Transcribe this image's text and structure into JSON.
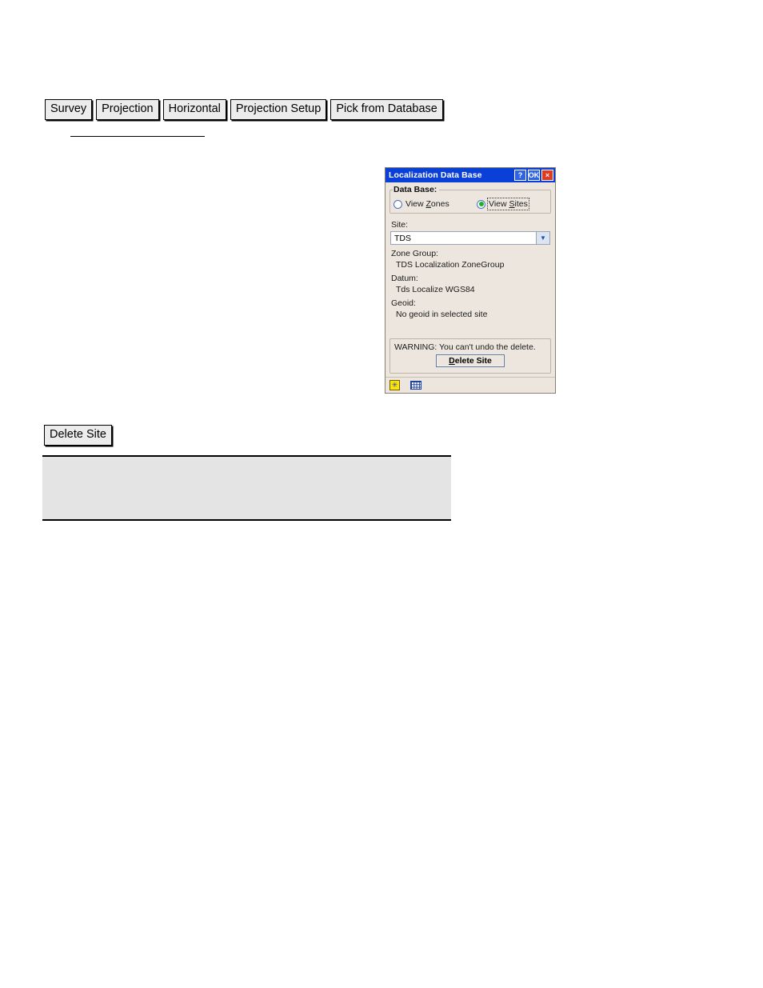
{
  "breadcrumb": {
    "items": [
      {
        "label": "Survey"
      },
      {
        "label": "Projection"
      },
      {
        "label": "Horizontal"
      },
      {
        "label": "Projection Setup"
      },
      {
        "label": "Pick from Database"
      }
    ]
  },
  "dialog": {
    "title": "Localization Data Base",
    "titlebar_buttons": {
      "help": "?",
      "ok": "OK",
      "close": "×"
    },
    "database_group": {
      "title": "Data Base:",
      "options": [
        {
          "label_before": "View ",
          "accel": "Z",
          "label_after": "ones",
          "selected": false
        },
        {
          "label_before": "View ",
          "accel": "S",
          "label_after": "ites",
          "selected": true
        }
      ]
    },
    "site": {
      "label": "Site:",
      "value": "TDS",
      "arrow": "▼"
    },
    "details": [
      {
        "key": "Zone Group:",
        "value": "TDS Localization ZoneGroup"
      },
      {
        "key": "Datum:",
        "value": "Tds Localize WGS84"
      },
      {
        "key": "Geoid:",
        "value": "No geoid in selected site"
      }
    ],
    "warning": {
      "text": "WARNING: You can't undo the delete.",
      "button_accel": "D",
      "button_rest": "elete Site"
    },
    "taskbar": {
      "items": [
        {
          "icon": "sun-icon",
          "glyph": "✳"
        },
        {
          "icon": "grid-icon",
          "glyph": ""
        }
      ]
    }
  },
  "lower_button": {
    "label": "Delete Site"
  },
  "colors": {
    "titlebar_blue": "#0A3FD8",
    "close_red": "#E03A20",
    "dialog_beige": "#ECE6DE",
    "radio_green": "#18B52C",
    "panel_gray": "#E4E4E4",
    "crumb_gray": "#ECECEC"
  }
}
